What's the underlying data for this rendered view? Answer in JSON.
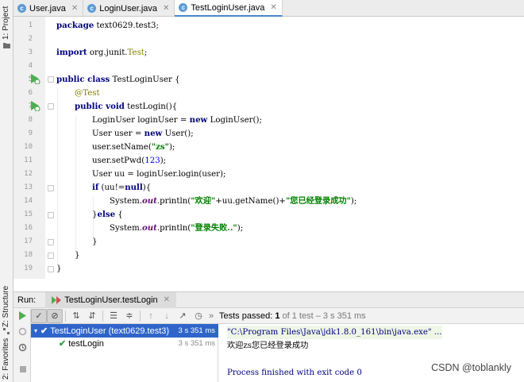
{
  "side_panel": {
    "project_label": "1: Project",
    "structure_label": "Z: Structure",
    "favorites_label": "2: Favorites"
  },
  "editor_tabs": [
    {
      "label": "User.java",
      "icon": "class-icon",
      "active": false
    },
    {
      "label": "LoginUser.java",
      "icon": "class-icon",
      "active": false
    },
    {
      "label": "TestLoginUser.java",
      "icon": "class-icon",
      "active": true
    }
  ],
  "code": {
    "line_numbers": [
      "1",
      "2",
      "3",
      "4",
      "5",
      "6",
      "7",
      "8",
      "9",
      "10",
      "11",
      "12",
      "13",
      "14",
      "15",
      "16",
      "17",
      "18",
      "19"
    ],
    "l1_kw": "package",
    "l1_rest": " text0629.test3;",
    "l3_kw": "import",
    "l3_a": " org.junit.",
    "l3_b": "Test",
    "l3_c": ";",
    "l5_kw": "public class",
    "l5_rest": " TestLoginUser {",
    "l6": "@Test",
    "l7_kw": "public void",
    "l7_rest": " testLogin(){",
    "l8_a": "LoginUser loginUser = ",
    "l8_kw": "new",
    "l8_b": " LoginUser();",
    "l9_a": "User user = ",
    "l9_kw": "new",
    "l9_b": " User();",
    "l10_a": "user.setName(",
    "l10_str": "\"zs\"",
    "l10_b": ");",
    "l11_a": "user.setPwd(",
    "l11_num": "123",
    "l11_b": ");",
    "l12": "User uu = loginUser.login(user);",
    "l13_kw": "if",
    "l13_a": " (uu!=",
    "l13_kw2": "null",
    "l13_b": "){",
    "l14_a": "System.",
    "l14_st": "out",
    "l14_b": ".println(",
    "l14_s1": "\"欢迎\"",
    "l14_c": "+uu.getName()+",
    "l14_s2": "\"您已经登录成功\"",
    "l14_d": ");",
    "l15_a": "}",
    "l15_kw": "else",
    "l15_b": " {",
    "l16_a": "System.",
    "l16_st": "out",
    "l16_b": ".println(",
    "l16_s": "\"登录失败..\"",
    "l16_c": ");",
    "l17": "}",
    "l18": "}",
    "l19": "}"
  },
  "run_panel": {
    "label": "Run:",
    "tab_label": "TestLoginUser.testLogin",
    "status_bold": "Tests passed: ",
    "status_count": "1",
    "status_rest": " of 1 test – 3 s 351 ms",
    "tree": [
      {
        "label": "TestLoginUser (text0629.test3)",
        "duration": "3 s 351 ms",
        "selected": true
      },
      {
        "label": "testLogin",
        "duration": "3 s 351 ms",
        "selected": false
      }
    ],
    "console": [
      "\"C:\\Program Files\\Java\\jdk1.8.0_161\\bin\\java.exe\" ...",
      "欢迎zs您已经登录成功",
      "",
      "Process finished with exit code 0"
    ]
  },
  "watermark": "CSDN @toblankly",
  "colors": {
    "accent": "#2f65ca",
    "keyword": "#000080",
    "string": "#008000",
    "pass": "#3aa046"
  }
}
